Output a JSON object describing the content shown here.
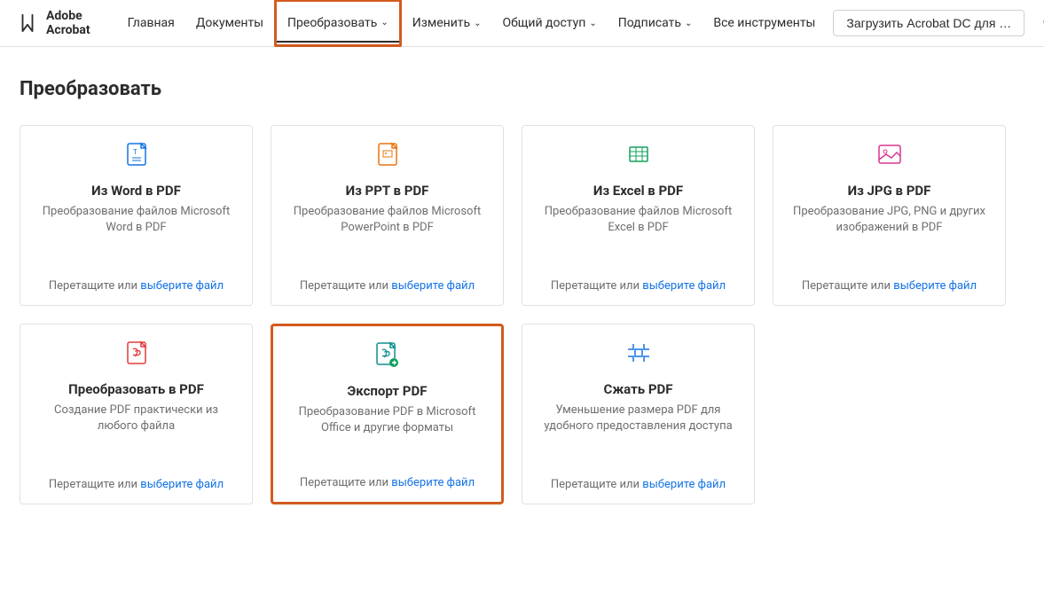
{
  "brand": "Adobe Acrobat",
  "nav": {
    "items": [
      {
        "label": "Главная",
        "hasDropdown": false
      },
      {
        "label": "Документы",
        "hasDropdown": false
      },
      {
        "label": "Преобразовать",
        "hasDropdown": true,
        "active": true
      },
      {
        "label": "Изменить",
        "hasDropdown": true
      },
      {
        "label": "Общий доступ",
        "hasDropdown": true
      },
      {
        "label": "Подписать",
        "hasDropdown": true
      },
      {
        "label": "Все инструменты",
        "hasDropdown": false
      }
    ],
    "download_button": "Загрузить Acrobat DC для …"
  },
  "page": {
    "title": "Преобразовать"
  },
  "dropzone": {
    "drag_text": "Перетащите или ",
    "select_link": "выберите файл"
  },
  "cards": [
    {
      "title": "Из Word в PDF",
      "desc": "Преобразование файлов Microsoft Word в PDF",
      "icon": "word"
    },
    {
      "title": "Из PPT в PDF",
      "desc": "Преобразование файлов Microsoft PowerPoint в PDF",
      "icon": "ppt"
    },
    {
      "title": "Из Excel в PDF",
      "desc": "Преобразование файлов Microsoft Excel в PDF",
      "icon": "excel"
    },
    {
      "title": "Из JPG в PDF",
      "desc": "Преобразование JPG, PNG и других изображений в PDF",
      "icon": "jpg"
    },
    {
      "title": "Преобразовать в PDF",
      "desc": "Создание PDF практически из любого файла",
      "icon": "pdf"
    },
    {
      "title": "Экспорт PDF",
      "desc": "Преобразование PDF в Microsoft Office и другие форматы",
      "icon": "export",
      "highlighted": true
    },
    {
      "title": "Сжать PDF",
      "desc": "Уменьшение размера PDF для удобного предоставления доступа",
      "icon": "compress"
    }
  ]
}
